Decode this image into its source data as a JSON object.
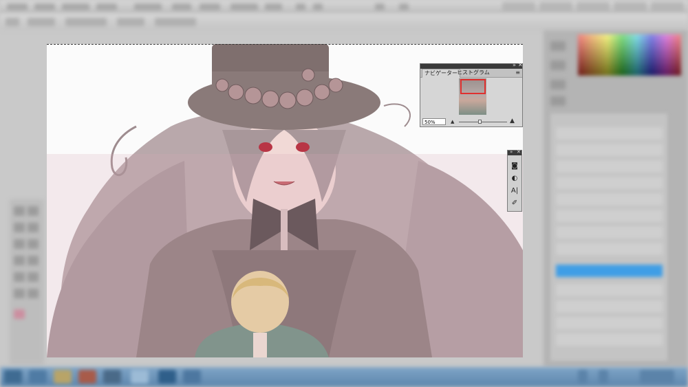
{
  "navigator": {
    "tab_navigator": "ナビゲーター",
    "tab_histogram": "ヒストグラム",
    "zoom_value": "50%",
    "menu_icon": "panel-menu-icon",
    "collapse_icon": "collapse-icon",
    "close_icon": "close-icon"
  },
  "mini_tools": {
    "icons": [
      "mask-icon",
      "adjustment-icon",
      "character-icon",
      "path-icon"
    ],
    "collapse_icon": "collapse-icon",
    "close_icon": "close-icon"
  },
  "layers": {
    "selected_color": "#3f9ee6"
  },
  "taskbar": {
    "items": [
      "start-icon",
      "media-icon",
      "folder-icon",
      "chrome-icon",
      "app-icon",
      "app-icon",
      "photoshop-icon",
      "app-icon"
    ]
  },
  "canvas": {
    "content": "illustration"
  }
}
